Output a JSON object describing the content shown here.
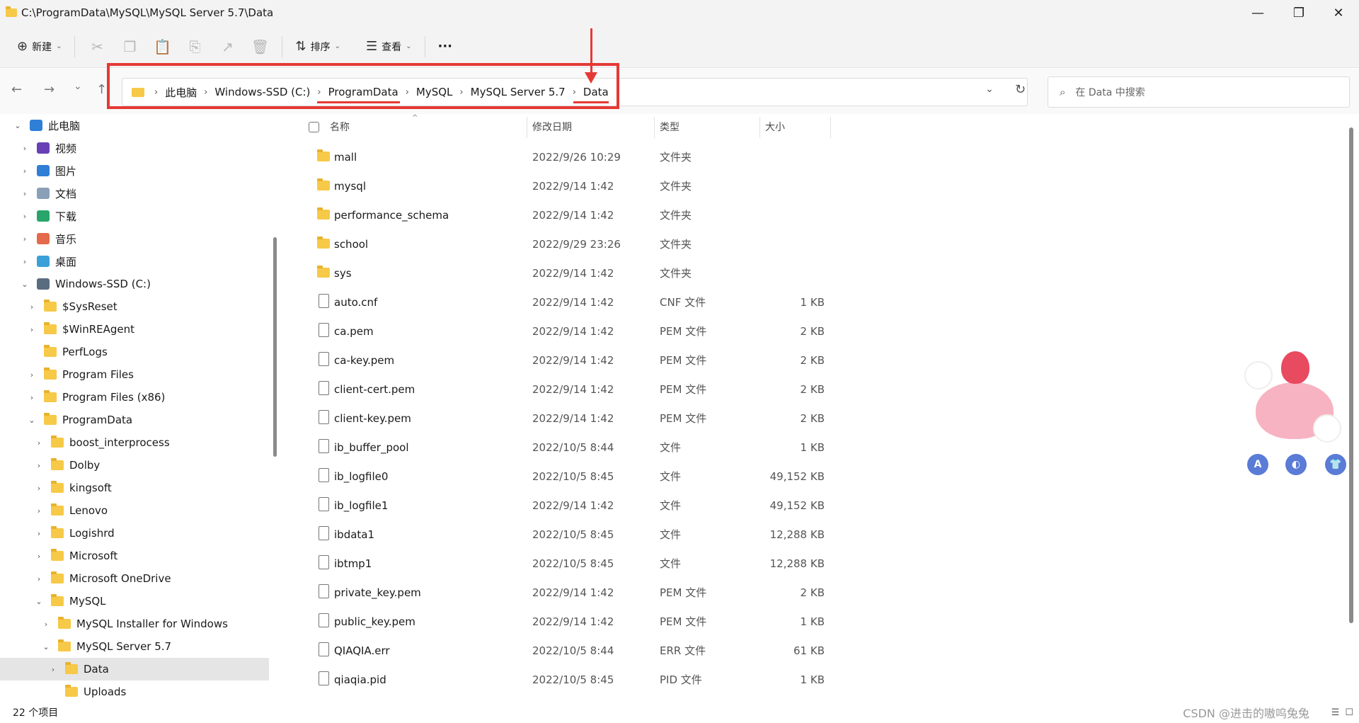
{
  "window": {
    "title": "C:\\ProgramData\\MySQL\\MySQL Server 5.7\\Data",
    "minimize": "—",
    "maximize": "❐",
    "close": "✕"
  },
  "toolbar": {
    "new_label": "新建",
    "sort_label": "排序",
    "view_label": "查看",
    "more_label": "···",
    "icons": [
      "cut-icon",
      "copy-icon",
      "paste-icon",
      "rename-icon",
      "share-icon",
      "delete-icon"
    ]
  },
  "nav": {
    "back": "←",
    "forward": "→",
    "recent": "⌄",
    "up": "↑",
    "breadcrumbs": [
      "此电脑",
      "Windows-SSD (C:)",
      "ProgramData",
      "MySQL",
      "MySQL Server 5.7",
      "Data"
    ],
    "search_placeholder": "在 Data 中搜索"
  },
  "sidebar": {
    "items": [
      {
        "label": "此电脑",
        "level": 0,
        "chev": "⌄",
        "icon": "computer"
      },
      {
        "label": "视频",
        "level": 1,
        "chev": "›",
        "icon": "video"
      },
      {
        "label": "图片",
        "level": 1,
        "chev": "›",
        "icon": "picture"
      },
      {
        "label": "文档",
        "level": 1,
        "chev": "›",
        "icon": "document"
      },
      {
        "label": "下载",
        "level": 1,
        "chev": "›",
        "icon": "download"
      },
      {
        "label": "音乐",
        "level": 1,
        "chev": "›",
        "icon": "music"
      },
      {
        "label": "桌面",
        "level": 1,
        "chev": "›",
        "icon": "desktop"
      },
      {
        "label": "Windows-SSD (C:)",
        "level": 1,
        "chev": "⌄",
        "icon": "drive"
      },
      {
        "label": "$SysReset",
        "level": 2,
        "chev": "›",
        "icon": "folder"
      },
      {
        "label": "$WinREAgent",
        "level": 2,
        "chev": "›",
        "icon": "folder"
      },
      {
        "label": "PerfLogs",
        "level": 2,
        "chev": "",
        "icon": "folder"
      },
      {
        "label": "Program Files",
        "level": 2,
        "chev": "›",
        "icon": "folder"
      },
      {
        "label": "Program Files (x86)",
        "level": 2,
        "chev": "›",
        "icon": "folder"
      },
      {
        "label": "ProgramData",
        "level": 2,
        "chev": "⌄",
        "icon": "folder"
      },
      {
        "label": "boost_interprocess",
        "level": 3,
        "chev": "›",
        "icon": "folder"
      },
      {
        "label": "Dolby",
        "level": 3,
        "chev": "›",
        "icon": "folder"
      },
      {
        "label": "kingsoft",
        "level": 3,
        "chev": "›",
        "icon": "folder"
      },
      {
        "label": "Lenovo",
        "level": 3,
        "chev": "›",
        "icon": "folder"
      },
      {
        "label": "Logishrd",
        "level": 3,
        "chev": "›",
        "icon": "folder"
      },
      {
        "label": "Microsoft",
        "level": 3,
        "chev": "›",
        "icon": "folder"
      },
      {
        "label": "Microsoft OneDrive",
        "level": 3,
        "chev": "›",
        "icon": "folder"
      },
      {
        "label": "MySQL",
        "level": 3,
        "chev": "⌄",
        "icon": "folder"
      },
      {
        "label": "MySQL Installer for Windows",
        "level": 4,
        "chev": "›",
        "icon": "folder"
      },
      {
        "label": "MySQL Server 5.7",
        "level": 4,
        "chev": "⌄",
        "icon": "folder"
      },
      {
        "label": "Data",
        "level": 5,
        "chev": "›",
        "icon": "folder",
        "selected": true
      },
      {
        "label": "Uploads",
        "level": 5,
        "chev": "",
        "icon": "folder"
      }
    ]
  },
  "columns": {
    "name": "名称",
    "date": "修改日期",
    "type": "类型",
    "size": "大小"
  },
  "files": [
    {
      "name": "mall",
      "date": "2022/9/26 10:29",
      "type": "文件夹",
      "size": "",
      "kind": "folder"
    },
    {
      "name": "mysql",
      "date": "2022/9/14 1:42",
      "type": "文件夹",
      "size": "",
      "kind": "folder"
    },
    {
      "name": "performance_schema",
      "date": "2022/9/14 1:42",
      "type": "文件夹",
      "size": "",
      "kind": "folder"
    },
    {
      "name": "school",
      "date": "2022/9/29 23:26",
      "type": "文件夹",
      "size": "",
      "kind": "folder"
    },
    {
      "name": "sys",
      "date": "2022/9/14 1:42",
      "type": "文件夹",
      "size": "",
      "kind": "folder"
    },
    {
      "name": "auto.cnf",
      "date": "2022/9/14 1:42",
      "type": "CNF 文件",
      "size": "1 KB",
      "kind": "file"
    },
    {
      "name": "ca.pem",
      "date": "2022/9/14 1:42",
      "type": "PEM 文件",
      "size": "2 KB",
      "kind": "file"
    },
    {
      "name": "ca-key.pem",
      "date": "2022/9/14 1:42",
      "type": "PEM 文件",
      "size": "2 KB",
      "kind": "file"
    },
    {
      "name": "client-cert.pem",
      "date": "2022/9/14 1:42",
      "type": "PEM 文件",
      "size": "2 KB",
      "kind": "file"
    },
    {
      "name": "client-key.pem",
      "date": "2022/9/14 1:42",
      "type": "PEM 文件",
      "size": "2 KB",
      "kind": "file"
    },
    {
      "name": "ib_buffer_pool",
      "date": "2022/10/5 8:44",
      "type": "文件",
      "size": "1 KB",
      "kind": "file"
    },
    {
      "name": "ib_logfile0",
      "date": "2022/10/5 8:45",
      "type": "文件",
      "size": "49,152 KB",
      "kind": "file"
    },
    {
      "name": "ib_logfile1",
      "date": "2022/9/14 1:42",
      "type": "文件",
      "size": "49,152 KB",
      "kind": "file"
    },
    {
      "name": "ibdata1",
      "date": "2022/10/5 8:45",
      "type": "文件",
      "size": "12,288 KB",
      "kind": "file"
    },
    {
      "name": "ibtmp1",
      "date": "2022/10/5 8:45",
      "type": "文件",
      "size": "12,288 KB",
      "kind": "file"
    },
    {
      "name": "private_key.pem",
      "date": "2022/9/14 1:42",
      "type": "PEM 文件",
      "size": "2 KB",
      "kind": "file"
    },
    {
      "name": "public_key.pem",
      "date": "2022/9/14 1:42",
      "type": "PEM 文件",
      "size": "1 KB",
      "kind": "file"
    },
    {
      "name": "QIAQIA.err",
      "date": "2022/10/5 8:44",
      "type": "ERR 文件",
      "size": "61 KB",
      "kind": "file"
    },
    {
      "name": "qiaqia.pid",
      "date": "2022/10/5 8:45",
      "type": "PID 文件",
      "size": "1 KB",
      "kind": "file"
    }
  ],
  "status": {
    "count": "22 个项目",
    "watermark": "CSDN @进击的嗷呜兔兔"
  },
  "widget_buttons": [
    "A",
    "◐",
    "👕"
  ],
  "colors": {
    "highlight": "#e53935",
    "folder": "#f7c948",
    "accent": "#5a7bd6"
  }
}
